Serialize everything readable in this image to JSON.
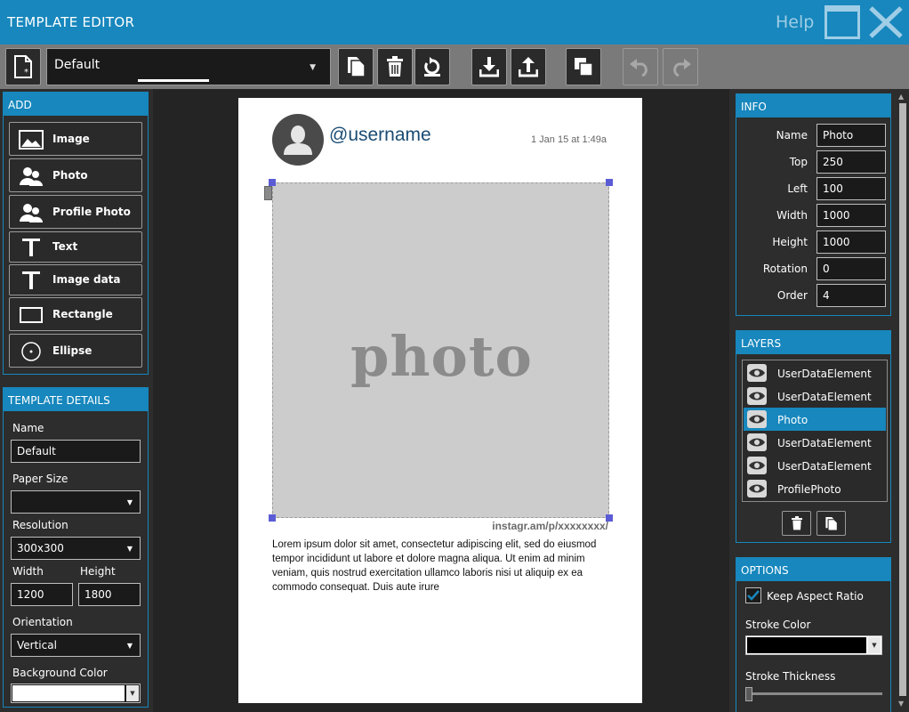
{
  "app": {
    "title": "TEMPLATE EDITOR",
    "help": "Help"
  },
  "toolbar": {
    "template_selected": "Default"
  },
  "add_panel": {
    "header": "ADD",
    "items": [
      {
        "label": "Image",
        "icon": "image-icon"
      },
      {
        "label": "Photo",
        "icon": "people-icon"
      },
      {
        "label": "Profile Photo",
        "icon": "people-icon"
      },
      {
        "label": "Text",
        "icon": "text-icon"
      },
      {
        "label": "Image data",
        "icon": "text-icon"
      },
      {
        "label": "Rectangle",
        "icon": "rectangle-icon"
      },
      {
        "label": "Ellipse",
        "icon": "ellipse-icon"
      }
    ]
  },
  "details": {
    "header": "TEMPLATE DETAILS",
    "name_label": "Name",
    "name_value": "Default",
    "paper_label": "Paper Size",
    "paper_value": "",
    "resolution_label": "Resolution",
    "resolution_value": "300x300",
    "width_label": "Width",
    "width_value": "1200",
    "height_label": "Height",
    "height_value": "1800",
    "orientation_label": "Orientation",
    "orientation_value": "Vertical",
    "bg_label": "Background Color",
    "bg_value": "#ffffff"
  },
  "preview": {
    "username": "@username",
    "date": "1 Jan 15 at 1:49a",
    "photo_text": "photo",
    "url": "instagr.am/p/xxxxxxxx/",
    "caption": "Lorem ipsum dolor sit amet, consectetur adipiscing elit, sed do eiusmod tempor incididunt ut labore et dolore magna aliqua. Ut enim ad minim veniam, quis nostrud exercitation ullamco laboris nisi ut aliquip ex ea commodo consequat. Duis aute irure"
  },
  "info": {
    "header": "INFO",
    "rows": [
      {
        "label": "Name",
        "value": "Photo"
      },
      {
        "label": "Top",
        "value": "250"
      },
      {
        "label": "Left",
        "value": "100"
      },
      {
        "label": "Width",
        "value": "1000"
      },
      {
        "label": "Height",
        "value": "1000"
      },
      {
        "label": "Rotation",
        "value": "0"
      },
      {
        "label": "Order",
        "value": "4"
      }
    ]
  },
  "layers": {
    "header": "LAYERS",
    "items": [
      {
        "name": "UserDataElement",
        "selected": false
      },
      {
        "name": "UserDataElement",
        "selected": false
      },
      {
        "name": "Photo",
        "selected": true
      },
      {
        "name": "UserDataElement",
        "selected": false
      },
      {
        "name": "UserDataElement",
        "selected": false
      },
      {
        "name": "ProfilePhoto",
        "selected": false
      }
    ]
  },
  "options": {
    "header": "OPTIONS",
    "keep_aspect_label": "Keep Aspect Ratio",
    "keep_aspect_checked": true,
    "stroke_color_label": "Stroke Color",
    "stroke_color_value": "#000000",
    "stroke_thickness_label": "Stroke Thickness",
    "stroke_thickness_value": 0
  },
  "colors": {
    "accent": "#1787bd",
    "selected_handle": "#5b5bd6"
  }
}
